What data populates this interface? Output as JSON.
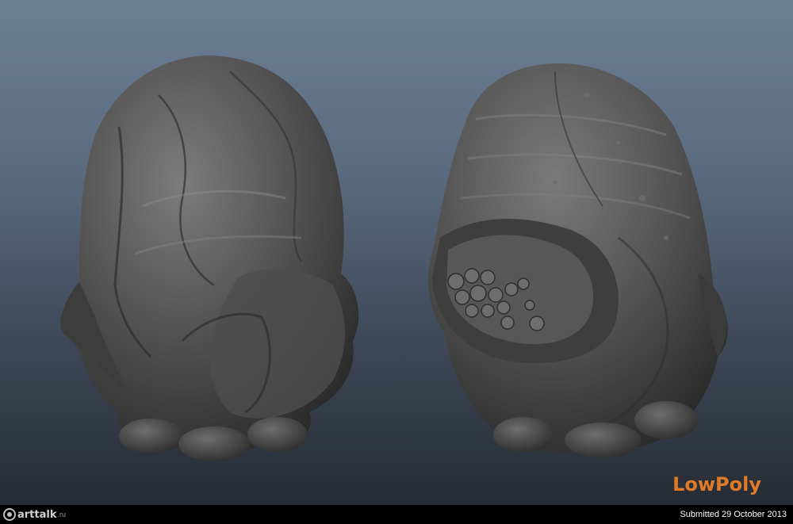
{
  "watermark": {
    "text": "LowPoly",
    "color": "#e07a26"
  },
  "footer": {
    "logo_text": "arttalk",
    "logo_domain": ".ru",
    "submitted": "Submitted 29 October 2013"
  },
  "colors": {
    "background_top": "#6d7f95",
    "background_bottom": "#262c35",
    "footer": "#000000",
    "model_surface": "#4a4a4a"
  }
}
